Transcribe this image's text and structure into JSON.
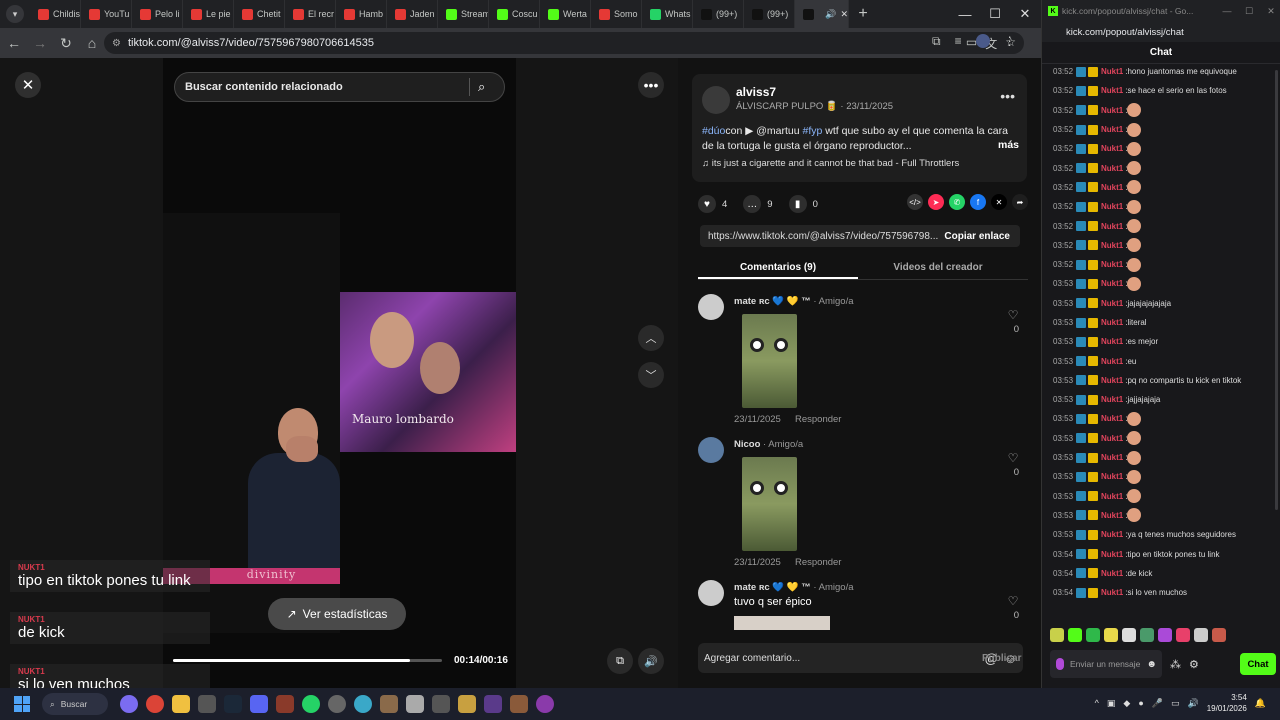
{
  "browser": {
    "tabs": [
      {
        "label": "Childis",
        "color": "#e53935",
        "icon": "youtube-icon"
      },
      {
        "label": "YouTu",
        "color": "#e53935",
        "icon": "youtube-icon"
      },
      {
        "label": "Pelo li",
        "color": "#e53935",
        "icon": "youtube-icon"
      },
      {
        "label": "Le pie",
        "color": "#e53935",
        "icon": "youtube-icon"
      },
      {
        "label": "Chetit",
        "color": "#e53935",
        "icon": "youtube-icon"
      },
      {
        "label": "El recr",
        "color": "#e53935",
        "icon": "youtube-icon"
      },
      {
        "label": "Hamb",
        "color": "#e53935",
        "icon": "youtube-icon"
      },
      {
        "label": "Jaden",
        "color": "#e53935",
        "icon": "youtube-icon"
      },
      {
        "label": "Stream",
        "color": "#53fc18",
        "icon": "kick-icon"
      },
      {
        "label": "Coscu",
        "color": "#53fc18",
        "icon": "kick-icon"
      },
      {
        "label": "Werta",
        "color": "#53fc18",
        "icon": "kick-icon"
      },
      {
        "label": "Somo",
        "color": "#e53935",
        "icon": "youtube-icon"
      },
      {
        "label": "Whats",
        "color": "#25d366",
        "icon": "whatsapp-icon"
      },
      {
        "label": "(99+)",
        "color": "#111111",
        "icon": "tiktok-icon"
      },
      {
        "label": "(99+)",
        "color": "#111111",
        "icon": "tiktok-icon"
      },
      {
        "label": "",
        "color": "#111111",
        "icon": "tiktok-icon"
      }
    ],
    "url": "tiktok.com/@alviss7/video/7575967980706614535"
  },
  "video": {
    "search_placeholder": "Buscar contenido relacionado",
    "caption": "Mauro lombardo",
    "banner_text": "divinity",
    "stats_label": "Ver estadísticas",
    "time": "00:14/00:16",
    "progress": 0.88
  },
  "overlay_messages": [
    {
      "user": "NUKT1",
      "text": "tipo en tiktok pones tu link"
    },
    {
      "user": "NUKT1",
      "text": "de kick"
    },
    {
      "user": "NUKT1",
      "text": "si lo ven muchos"
    }
  ],
  "post": {
    "username": "alviss7",
    "meta": "ÁLVISCARP PULPO 🥫 · 23/11/2025",
    "hashtag1": "#dúo",
    "word_con": "con",
    "mention": "▶ @martuu",
    "hashtag2": "#fyp",
    "description_rest": "wtf que subo ay el que comenta la cara de la tortuga le gusta el órgano reproductor...",
    "more": "más",
    "song": "♫  its just a cigarette and it cannot be that bad - Full Throttlers",
    "likes": "4",
    "comments": "9",
    "saves": "0",
    "link": "https://www.tiktok.com/@alviss7/video/757596798...",
    "copy_link": "Copiar enlace",
    "tab_comments": "Comentarios (9)",
    "tab_creator": "Videos del creador"
  },
  "comments": [
    {
      "name": "mate ʀᴄ 💙 💛 ™",
      "tag": "· Amigo/a",
      "date": "23/11/2025",
      "reply": "Responder",
      "likes": "0",
      "text": ""
    },
    {
      "name": "Nicoo",
      "tag": "· Amigo/a",
      "date": "23/11/2025",
      "reply": "Responder",
      "likes": "0",
      "text": ""
    },
    {
      "name": "mate ʀᴄ 💙 💛 ™",
      "tag": "· Amigo/a",
      "date": "",
      "reply": "",
      "likes": "0",
      "text": "tuvo q ser épico"
    }
  ],
  "add_comment": {
    "placeholder": "Agregar comentario...",
    "publish": "Publicar"
  },
  "chat": {
    "window_title": "kick.com/popout/alvissj/chat - Go...",
    "url": "kick.com/popout/alvissj/chat",
    "header": "Chat",
    "messages": [
      {
        "ts": "03:52",
        "user": "Nukt1",
        "text": "hono juantomas me equivoque"
      },
      {
        "ts": "03:52",
        "user": "Nukt1",
        "text": "se hace el serio en las fotos"
      },
      {
        "ts": "03:52",
        "user": "Nukt1",
        "text": ""
      },
      {
        "ts": "03:52",
        "user": "Nukt1",
        "text": ""
      },
      {
        "ts": "03:52",
        "user": "Nukt1",
        "text": ""
      },
      {
        "ts": "03:52",
        "user": "Nukt1",
        "text": ""
      },
      {
        "ts": "03:52",
        "user": "Nukt1",
        "text": ""
      },
      {
        "ts": "03:52",
        "user": "Nukt1",
        "text": ""
      },
      {
        "ts": "03:52",
        "user": "Nukt1",
        "text": ""
      },
      {
        "ts": "03:52",
        "user": "Nukt1",
        "text": ""
      },
      {
        "ts": "03:52",
        "user": "Nukt1",
        "text": ""
      },
      {
        "ts": "03:53",
        "user": "Nukt1",
        "text": ""
      },
      {
        "ts": "03:53",
        "user": "Nukt1",
        "text": "jajajajajajaja"
      },
      {
        "ts": "03:53",
        "user": "Nukt1",
        "text": "literal"
      },
      {
        "ts": "03:53",
        "user": "Nukt1",
        "text": "es mejor"
      },
      {
        "ts": "03:53",
        "user": "Nukt1",
        "text": "eu"
      },
      {
        "ts": "03:53",
        "user": "Nukt1",
        "text": "pq no compartis tu kick en tiktok"
      },
      {
        "ts": "03:53",
        "user": "Nukt1",
        "text": "jajjajajaja"
      },
      {
        "ts": "03:53",
        "user": "Nukt1",
        "text": ""
      },
      {
        "ts": "03:53",
        "user": "Nukt1",
        "text": ""
      },
      {
        "ts": "03:53",
        "user": "Nukt1",
        "text": ""
      },
      {
        "ts": "03:53",
        "user": "Nukt1",
        "text": ""
      },
      {
        "ts": "03:53",
        "user": "Nukt1",
        "text": ""
      },
      {
        "ts": "03:53",
        "user": "Nukt1",
        "text": ""
      },
      {
        "ts": "03:53",
        "user": "Nukt1",
        "text": "ya q tenes muchos seguidores"
      },
      {
        "ts": "03:54",
        "user": "Nukt1",
        "text": "tipo en tiktok pones tu link"
      },
      {
        "ts": "03:54",
        "user": "Nukt1",
        "text": "de kick"
      },
      {
        "ts": "03:54",
        "user": "Nukt1",
        "text": "si lo ven muchos"
      }
    ],
    "send_placeholder": "Enviar un mensaje",
    "chat_button": "Chat"
  },
  "taskbar": {
    "search": "Buscar",
    "time": "3:54",
    "date": "19/01/2026"
  }
}
